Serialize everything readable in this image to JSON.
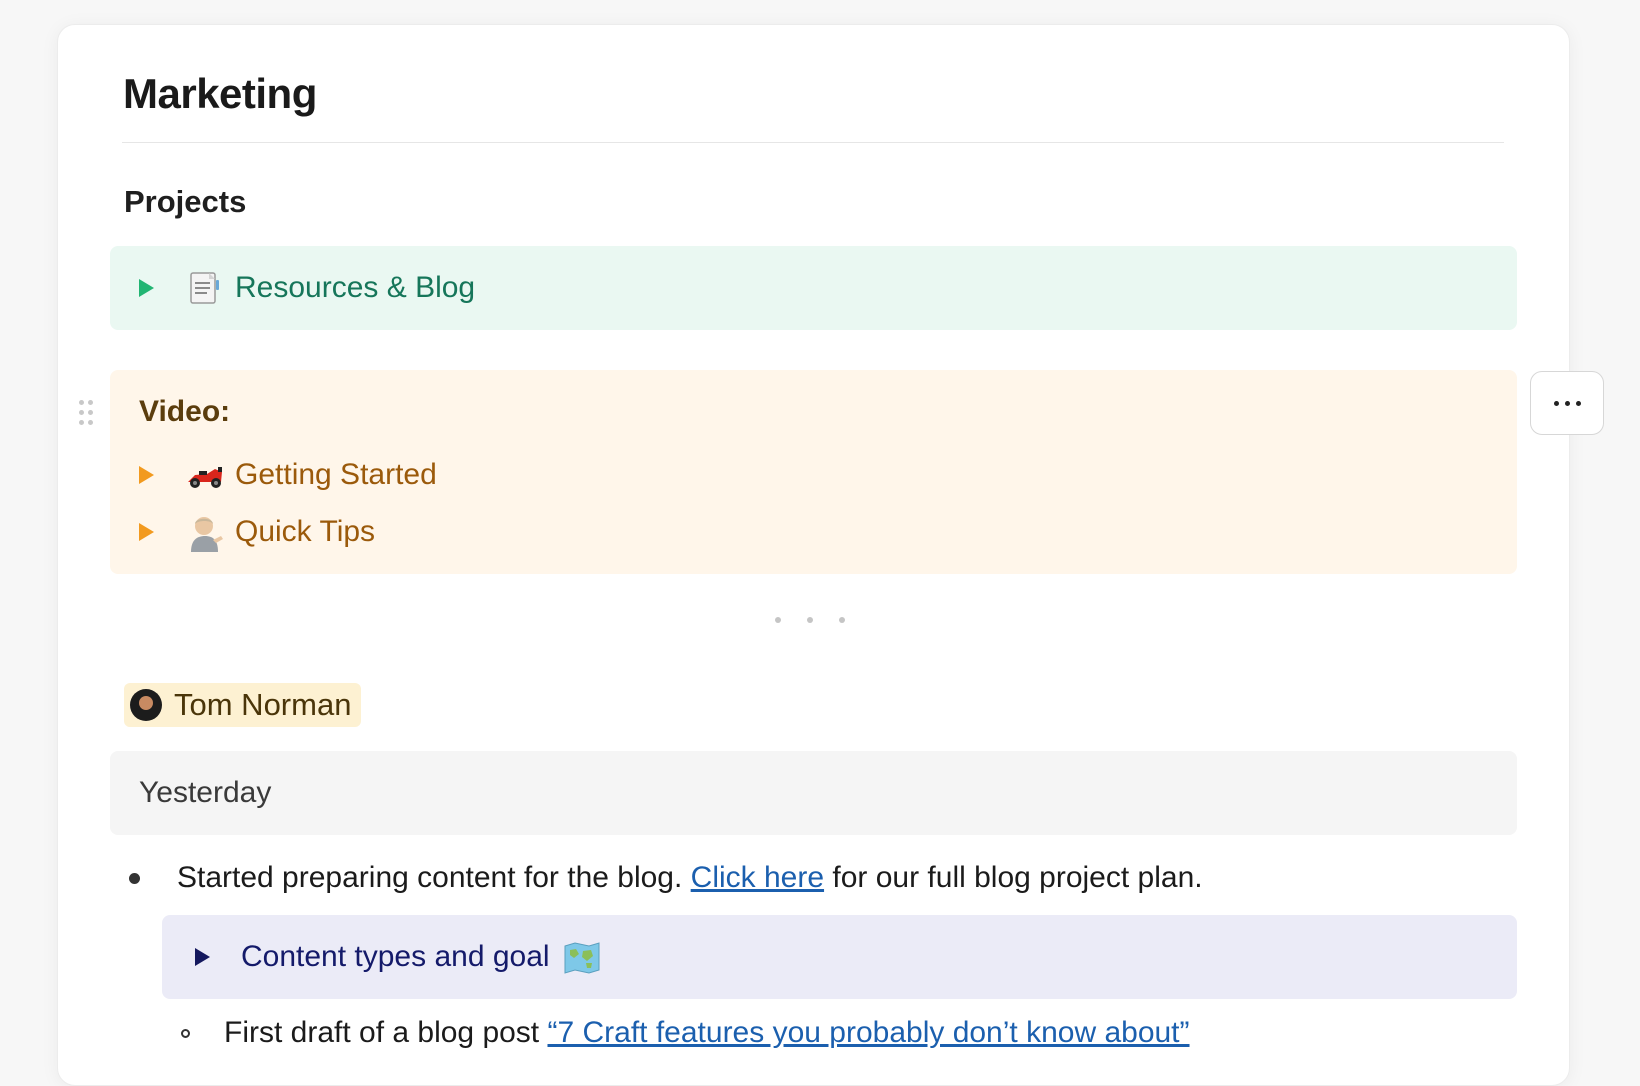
{
  "page": {
    "title": "Marketing"
  },
  "projects": {
    "heading": "Projects",
    "resources_blog": {
      "label": "Resources & Blog",
      "icon": "document-icon",
      "color": "#16765a"
    }
  },
  "video": {
    "label": "Video:",
    "items": [
      {
        "label": "Getting Started",
        "icon": "race-car-icon"
      },
      {
        "label": "Quick Tips",
        "icon": "person-tipping-hand-icon"
      }
    ]
  },
  "journal": {
    "mention_name": "Tom Norman",
    "date_label": "Yesterday",
    "bullet": {
      "text_before": "Started preparing content for the blog. ",
      "link_text": "Click here",
      "text_after": " for our full blog project plan."
    },
    "content_toggle": {
      "label": "Content types and goal",
      "icon": "world-map-icon"
    },
    "sub_bullet": {
      "text_before": "First draft of a blog post ",
      "link_text": "“7 Craft features you probably don’t know about”"
    }
  },
  "colors": {
    "green_block": "#eaf8f2",
    "orange_block": "#fff6ea",
    "lavender_block": "#ebebf7",
    "link": "#1b5fae"
  }
}
